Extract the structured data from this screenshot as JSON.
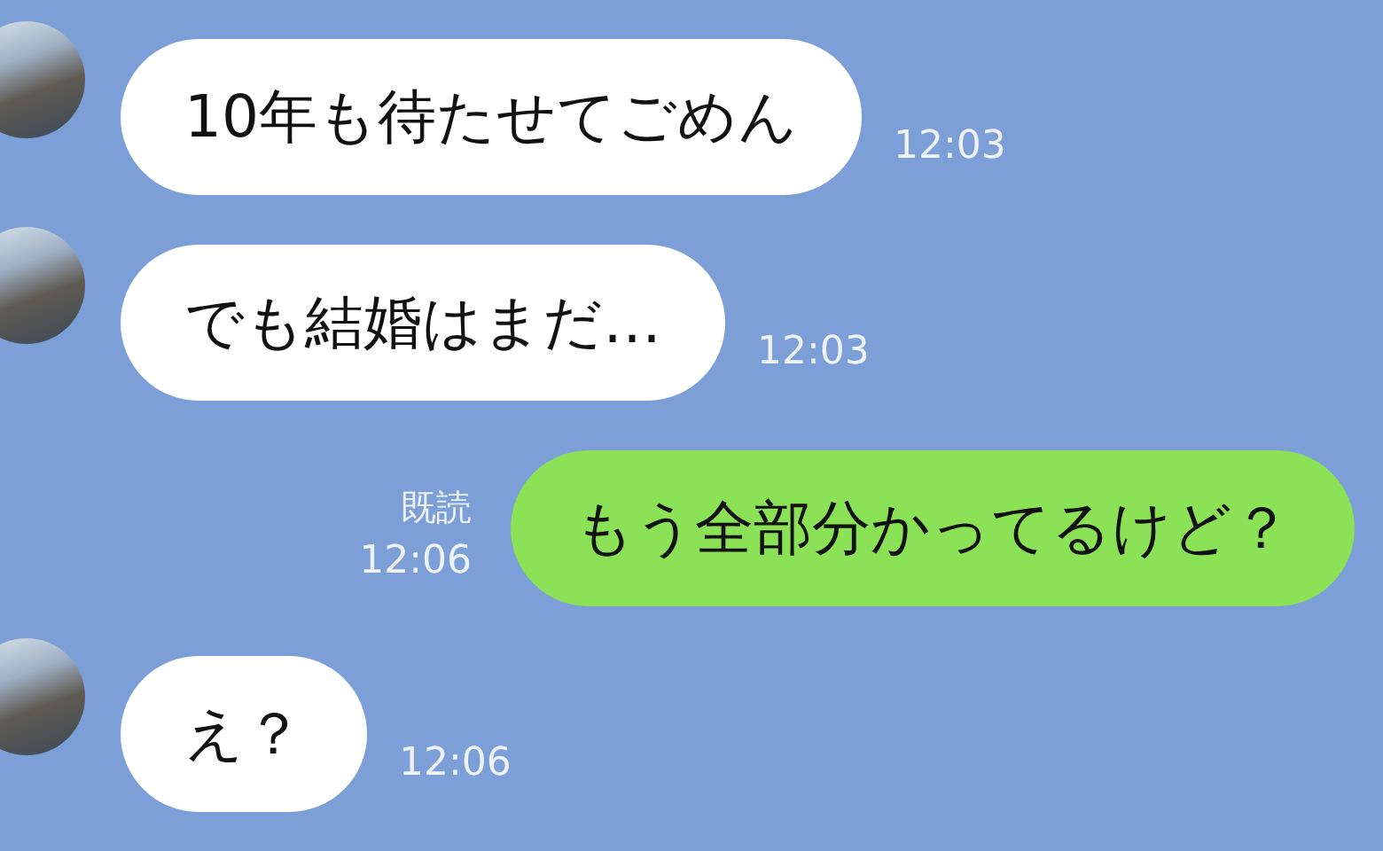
{
  "messages": [
    {
      "kind": "received",
      "text": "10年も待たせてごめん",
      "time": "12:03"
    },
    {
      "kind": "received",
      "text": "でも結婚はまだ…",
      "time": "12:03"
    },
    {
      "kind": "sent",
      "text": "もう全部分かってるけど？",
      "read": "既読",
      "time": "12:06"
    },
    {
      "kind": "received",
      "text": "え？",
      "time": "12:06"
    }
  ]
}
